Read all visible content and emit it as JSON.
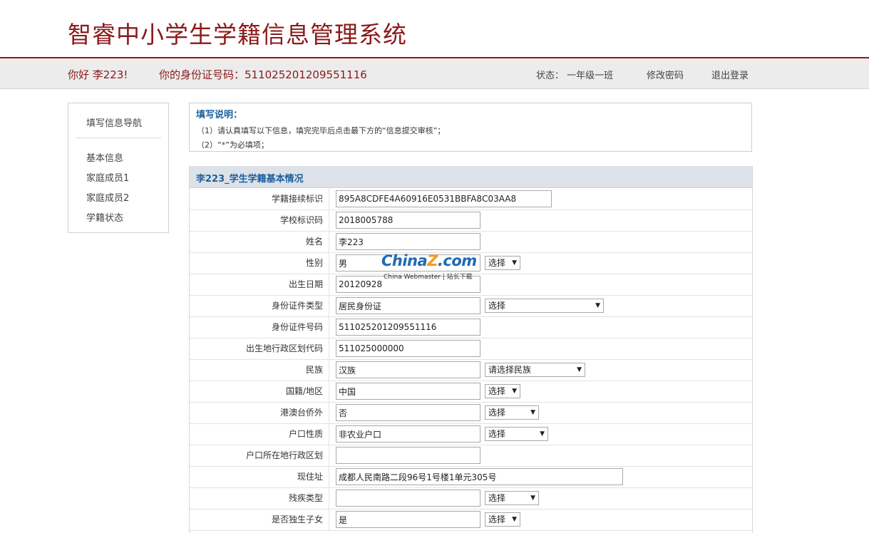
{
  "header": {
    "title": "智睿中小学生学籍信息管理系统"
  },
  "userbar": {
    "greeting": "你好 李223!",
    "id_label": "你的身份证号码：511025201209551116",
    "status": "状态：  一年级一班",
    "change_password": "修改密码",
    "logout": "退出登录"
  },
  "sidebar": {
    "title": "填写信息导航",
    "items": [
      {
        "label": "基本信息"
      },
      {
        "label": "家庭成员1"
      },
      {
        "label": "家庭成员2"
      },
      {
        "label": "学籍状态"
      }
    ]
  },
  "instructions": {
    "title": "填写说明：",
    "line1": "（1）请认真填写以下信息，填完完毕后点击最下方的“信息提交审核”；",
    "line2_prefix": "（2）“",
    "line2_star": "*",
    "line2_suffix": "”为必填项；"
  },
  "form": {
    "title": "李223_学生学籍基本情况",
    "rows": [
      {
        "label": "学籍接续标识",
        "value": "895A8CDFE4A60916E0531BBFA8C03AA8"
      },
      {
        "label": "学校标识码",
        "value": "2018005788"
      },
      {
        "label": "姓名",
        "value": "李223"
      },
      {
        "label": "性别",
        "value": "男",
        "select": "选择"
      },
      {
        "label": "出生日期",
        "value": "20120928"
      },
      {
        "label": "身份证件类型",
        "value": "居民身份证",
        "select": "选择"
      },
      {
        "label": "身份证件号码",
        "value": "511025201209551116"
      },
      {
        "label": "出生地行政区划代码",
        "value": "511025000000"
      },
      {
        "label": "民族",
        "value": "汉族",
        "select": "请选择民族"
      },
      {
        "label": "国籍/地区",
        "value": "中国",
        "select": "选择"
      },
      {
        "label": "港澳台侨外",
        "value": "否",
        "select": "选择"
      },
      {
        "label": "户口性质",
        "value": "非农业户口",
        "select": "选择"
      },
      {
        "label": "户口所在地行政区划",
        "value": ""
      },
      {
        "label": "现住址",
        "value": "成都人民南路二段96号1号楼1单元305号"
      },
      {
        "label": "残疾类型",
        "value": "",
        "select": "选择"
      },
      {
        "label": "是否独生子女",
        "value": "是",
        "select": "选择"
      }
    ]
  },
  "watermark": {
    "brand_a": "China",
    "brand_z": "Z",
    "brand_b": ".com",
    "sub": "China Webmaster | 站长下载"
  },
  "icons": {
    "dropdown": "chevron-down-icon"
  },
  "colors": {
    "brand": "#8b1a1a",
    "accent": "#1e5f9e",
    "required": "#cc0000"
  }
}
